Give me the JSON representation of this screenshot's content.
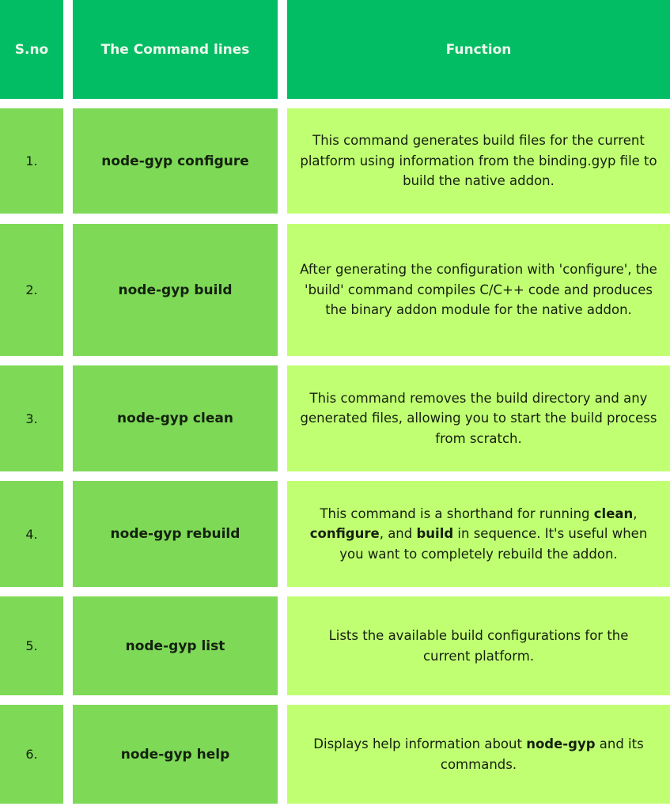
{
  "header": {
    "sno": "S.no",
    "command": "The Command lines",
    "function": "Function"
  },
  "colors": {
    "header_bg": "#02bd63",
    "header_text": "#eef8ee",
    "left_cell_bg": "#7ed957",
    "function_cell_bg": "#c1ff72",
    "body_text": "#14210f"
  },
  "rows": [
    {
      "sno": "1.",
      "command": "node-gyp configure",
      "function": [
        {
          "text": "This command generates build files for the current platform using information from the binding.gyp file to build the native addon.",
          "bold": false
        }
      ]
    },
    {
      "sno": "2.",
      "command": "node-gyp build",
      "function": [
        {
          "text": "After generating the configuration with 'configure', the 'build' command compiles C/C++ code and produces the binary addon module for the native addon.",
          "bold": false
        }
      ]
    },
    {
      "sno": "3.",
      "command": "node-gyp clean",
      "function": [
        {
          "text": "This command removes the build directory and any generated files, allowing you to start the build process from scratch.",
          "bold": false
        }
      ]
    },
    {
      "sno": "4.",
      "command": "node-gyp rebuild",
      "function": [
        {
          "text": "This command is a shorthand for running ",
          "bold": false
        },
        {
          "text": "clean",
          "bold": true
        },
        {
          "text": ", ",
          "bold": false
        },
        {
          "text": "configure",
          "bold": true
        },
        {
          "text": ", and ",
          "bold": false
        },
        {
          "text": "build",
          "bold": true
        },
        {
          "text": " in sequence. It's useful when you want to completely rebuild the addon.",
          "bold": false
        }
      ]
    },
    {
      "sno": "5.",
      "command": "node-gyp list",
      "function": [
        {
          "text": "Lists the available build configurations for the current platform.",
          "bold": false
        }
      ]
    },
    {
      "sno": "6.",
      "command": "node-gyp help",
      "function": [
        {
          "text": "Displays help information about ",
          "bold": false
        },
        {
          "text": "node-gyp",
          "bold": true
        },
        {
          "text": " and its commands.",
          "bold": false
        }
      ]
    }
  ]
}
